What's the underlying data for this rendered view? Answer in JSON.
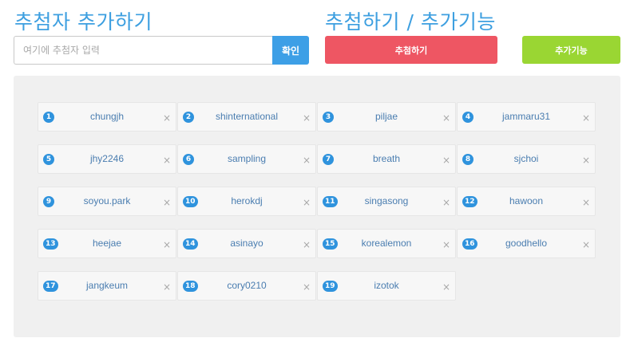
{
  "left_section": {
    "title": "추첨자 추가하기",
    "input_placeholder": "여기에 추첨자 입력",
    "input_value": "",
    "confirm_label": "확인"
  },
  "right_section": {
    "title": "추첨하기 / 추가기능",
    "draw_label": "추첨하기",
    "extra_label": "추가기능"
  },
  "colors": {
    "accent_blue": "#3d9fe0",
    "draw_red": "#ee5663",
    "extra_green": "#9ad633",
    "badge_blue": "#2f93dd",
    "panel_gray": "#f0f0f0"
  },
  "icons": {
    "remove": "close-icon"
  },
  "remove_glyph": "×",
  "entries": [
    {
      "num": "1",
      "name": "chungjh"
    },
    {
      "num": "2",
      "name": "shinternational"
    },
    {
      "num": "3",
      "name": "piljae"
    },
    {
      "num": "4",
      "name": "jammaru31"
    },
    {
      "num": "5",
      "name": "jhy2246"
    },
    {
      "num": "6",
      "name": "sampling"
    },
    {
      "num": "7",
      "name": "breath"
    },
    {
      "num": "8",
      "name": "sjchoi"
    },
    {
      "num": "9",
      "name": "soyou.park"
    },
    {
      "num": "10",
      "name": "herokdj"
    },
    {
      "num": "11",
      "name": "singasong"
    },
    {
      "num": "12",
      "name": "hawoon"
    },
    {
      "num": "13",
      "name": "heejae"
    },
    {
      "num": "14",
      "name": "asinayo"
    },
    {
      "num": "15",
      "name": "korealemon"
    },
    {
      "num": "16",
      "name": "goodhello"
    },
    {
      "num": "17",
      "name": "jangkeum"
    },
    {
      "num": "18",
      "name": "cory0210"
    },
    {
      "num": "19",
      "name": "izotok"
    }
  ]
}
